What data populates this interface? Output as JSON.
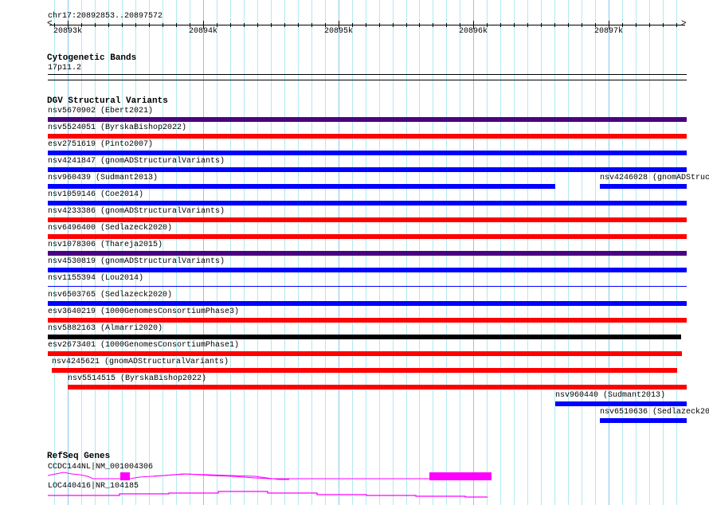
{
  "ruler": {
    "location": "chr17:20892853..20897572",
    "tick_labels": [
      "20893k",
      "20894k",
      "20895k",
      "20896k",
      "20897k"
    ]
  },
  "cytobands": {
    "title": "Cytogenetic Bands",
    "band": "17p11.2"
  },
  "dgv": {
    "title": "DGV Structural Variants",
    "colors": {
      "purple": "#4b0082",
      "red": "#ff0000",
      "blue": "#0000ff",
      "black": "#000000"
    },
    "features": [
      {
        "label": "nsv5670902 (Ebert2021)",
        "color": "purple",
        "start": 0,
        "end": 1,
        "row": 0
      },
      {
        "label": "nsv5524051 (ByrskaBishop2022)",
        "color": "red",
        "start": 0,
        "end": 1,
        "row": 1
      },
      {
        "label": "esv2751619 (Pinto2007)",
        "color": "blue",
        "start": 0,
        "end": 1,
        "row": 2
      },
      {
        "label": "nsv4241847 (gnomADStructuralVariants)",
        "color": "blue",
        "start": 0,
        "end": 1,
        "row": 3
      },
      {
        "label": "nsv960439 (Sudmant2013)",
        "color": "blue",
        "start": 0,
        "end": 0.794,
        "row": 4
      },
      {
        "label": "nsv4246028 (gnomADStruc",
        "color": "blue",
        "start": 0.864,
        "end": 1,
        "row": 4
      },
      {
        "label": "nsv1059146 (Coe2014)",
        "color": "blue",
        "start": 0,
        "end": 1,
        "row": 5
      },
      {
        "label": "nsv4233386 (gnomADStructuralVariants)",
        "color": "red",
        "start": 0,
        "end": 1,
        "row": 6
      },
      {
        "label": "nsv6496400 (Sedlazeck2020)",
        "color": "red",
        "start": 0,
        "end": 1,
        "row": 7
      },
      {
        "label": "nsv1078306 (Thareja2015)",
        "color": "purple",
        "start": 0,
        "end": 1,
        "row": 8
      },
      {
        "label": "nsv4530819 (gnomADStructuralVariants)",
        "color": "blue",
        "start": 0,
        "end": 1,
        "row": 9
      },
      {
        "label": "nsv1155394 (Lou2014)",
        "color": "blue",
        "start": 0,
        "end": 1,
        "row": 10,
        "thin": true
      },
      {
        "label": "nsv6503765 (Sedlazeck2020)",
        "color": "blue",
        "start": 0,
        "end": 1,
        "row": 11
      },
      {
        "label": "esv3640219 (1000GenomesConsortiumPhase3)",
        "color": "red",
        "start": 0,
        "end": 1,
        "row": 12
      },
      {
        "label": "nsv5882163 (Almarri2020)",
        "color": "black",
        "start": 0,
        "end": 0.991,
        "row": 13
      },
      {
        "label": "esv2673401 (1000GenomesConsortiumPhase1)",
        "color": "red",
        "start": 0,
        "end": 0.993,
        "row": 14
      },
      {
        "label": "nsv4245621 (gnomADStructuralVariants)",
        "color": "red",
        "start": 0.006,
        "end": 0.985,
        "row": 15
      },
      {
        "label": "nsv5514515 (ByrskaBishop2022)",
        "color": "red",
        "start": 0.031,
        "end": 1,
        "row": 16
      },
      {
        "label": "nsv960440 (Sudmant2013)",
        "color": "blue",
        "start": 0.794,
        "end": 1,
        "row": 17
      },
      {
        "label": "nsv6510636 (Sedlazeck20",
        "color": "blue",
        "start": 0.864,
        "end": 1,
        "row": 18
      }
    ]
  },
  "refseq": {
    "title": "RefSeq Genes",
    "color": "#ff00ff",
    "genes": [
      {
        "label": "CCDC144NL|NM_001004306"
      },
      {
        "label": "LOC440416|NR_104185"
      }
    ]
  }
}
